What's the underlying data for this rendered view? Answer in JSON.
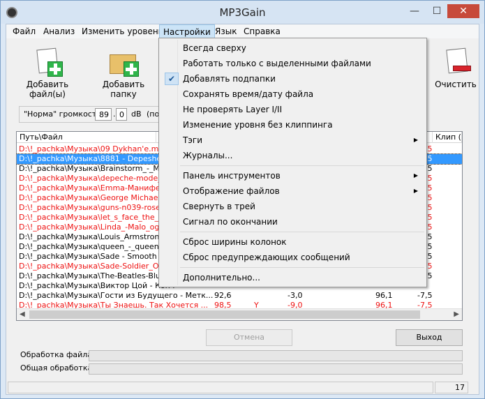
{
  "window": {
    "title": "MP3Gain",
    "minimize": "—",
    "maximize": "☐",
    "close": "✕"
  },
  "menu": [
    "Файл",
    "Анализ",
    "Изменить уровень",
    "Настройки",
    "Язык",
    "Справка"
  ],
  "toolbar": {
    "add_files": "Добавить файл(ы)",
    "add_folder": "Добавить папку",
    "clear": "Очистить"
  },
  "norm": {
    "label": "\"Норма\" громкости:",
    "int": "89",
    "dot": ".",
    "dec": "0",
    "unit": "dB",
    "suffix": "(по у"
  },
  "list": {
    "headers": {
      "path": "Путь\\Файл",
      "clip": "Клип ("
    },
    "rows": [
      {
        "path": "D:\\!_pachka\\Музыка\\09 Dykhan'e.mp3",
        "c1": "",
        "c2": "",
        "c3": "",
        "c4": "",
        "c5": "-7,5",
        "red": true,
        "sel": false
      },
      {
        "path": "D:\\!_pachka\\Музыка\\8881 - Depeshe_M",
        "c1": "",
        "c2": "",
        "c3": "",
        "c4": "",
        "c5": "-7,5",
        "red": false,
        "sel": true
      },
      {
        "path": "D:\\!_pachka\\Музыка\\Brainstorm_-_Mayb",
        "c1": "",
        "c2": "",
        "c3": "",
        "c4": "",
        "c5": "-7,5",
        "red": false,
        "sel": false
      },
      {
        "path": "D:\\!_pachka\\Музыка\\depeche-mode_wal",
        "c1": "",
        "c2": "",
        "c3": "",
        "c4": "",
        "c5": "-7,5",
        "red": true,
        "sel": false
      },
      {
        "path": "D:\\!_pachka\\Музыка\\Emma-Манифест.m",
        "c1": "",
        "c2": "",
        "c3": "",
        "c4": "",
        "c5": "-7,5",
        "red": true,
        "sel": false
      },
      {
        "path": "D:\\!_pachka\\Музыка\\George Michael - Je",
        "c1": "",
        "c2": "",
        "c3": "",
        "c4": "",
        "c5": "-7,5",
        "red": true,
        "sel": false
      },
      {
        "path": "D:\\!_pachka\\Музыка\\guns-n039-roses-kr",
        "c1": "",
        "c2": "",
        "c3": "",
        "c4": "",
        "c5": "-7,5",
        "red": true,
        "sel": false
      },
      {
        "path": "D:\\!_pachka\\Музыка\\let_s_face_the_mus",
        "c1": "",
        "c2": "",
        "c3": "",
        "c4": "",
        "c5": "-7,5",
        "red": true,
        "sel": false
      },
      {
        "path": "D:\\!_pachka\\Музыка\\Linda_-Malo_ognya",
        "c1": "",
        "c2": "",
        "c3": "",
        "c4": "",
        "c5": "-7,5",
        "red": true,
        "sel": false
      },
      {
        "path": "D:\\!_pachka\\Музыка\\Louis_Armstrong_-_",
        "c1": "",
        "c2": "",
        "c3": "",
        "c4": "",
        "c5": "-7,5",
        "red": false,
        "sel": false
      },
      {
        "path": "D:\\!_pachka\\Музыка\\queen_-_queen_-_v",
        "c1": "",
        "c2": "",
        "c3": "",
        "c4": "",
        "c5": "-7,5",
        "red": false,
        "sel": false
      },
      {
        "path": "D:\\!_pachka\\Музыка\\Sade - Smooth Ope",
        "c1": "",
        "c2": "",
        "c3": "",
        "c4": "",
        "c5": "-7,5",
        "red": false,
        "sel": false
      },
      {
        "path": "D:\\!_pachka\\Музыка\\Sade-Soldier_Of_Lo",
        "c1": "",
        "c2": "",
        "c3": "",
        "c4": "",
        "c5": "-7,5",
        "red": true,
        "sel": false
      },
      {
        "path": "D:\\!_pachka\\Музыка\\The-Beatles-Blue-Bl",
        "c1": "",
        "c2": "",
        "c3": "",
        "c4": "",
        "c5": "-7,5",
        "red": false,
        "sel": false
      },
      {
        "path": "D:\\!_pachka\\Музыка\\Виктор Цой - Конч",
        "c1": "",
        "c2": "",
        "c3": "",
        "c4": "",
        "c5": "",
        "red": false,
        "sel": false
      },
      {
        "path": "D:\\!_pachka\\Музыка\\Гости из Будущего - Метк...",
        "c1": "92,6",
        "c2": "",
        "c3": "-3,0",
        "c4": "96,1",
        "c5": "-7,5",
        "red": false,
        "sel": false
      },
      {
        "path": "D:\\!_pachka\\Музыка\\Ты Знаешь. Так Хочется ...",
        "c1": "98,5",
        "c2": "Y",
        "c3": "-9,0",
        "c4": "96,1",
        "c5": "-7,5",
        "red": true,
        "sel": false
      }
    ]
  },
  "buttons": {
    "cancel": "Отмена",
    "exit": "Выход"
  },
  "progress": {
    "file": "Обработка файла",
    "total": "Общая обработка",
    "file_value": 0,
    "total_value": 0
  },
  "status": {
    "count": "17"
  },
  "dropdown": {
    "items": [
      {
        "label": "Всегда сверху",
        "checked": false,
        "sub": false
      },
      {
        "label": "Работать только с выделенными файлами",
        "checked": false,
        "sub": false
      },
      {
        "label": "Добавлять подпапки",
        "checked": true,
        "sub": false
      },
      {
        "label": "Сохранять время/дату файла",
        "checked": false,
        "sub": false
      },
      {
        "label": "Не проверять Layer I/II",
        "checked": false,
        "sub": false
      },
      {
        "label": "Изменение уровня без клиппинга",
        "checked": false,
        "sub": false
      },
      {
        "label": "Тэги",
        "checked": false,
        "sub": true
      },
      {
        "label": "Журналы...",
        "checked": false,
        "sub": false
      },
      {
        "label": "Панель инструментов",
        "checked": false,
        "sub": true
      },
      {
        "label": "Отображение файлов",
        "checked": false,
        "sub": true
      },
      {
        "label": "Свернуть в трей",
        "checked": false,
        "sub": false
      },
      {
        "label": "Сигнал по окончании",
        "checked": false,
        "sub": false
      },
      {
        "label": "Сброс ширины колонок",
        "checked": false,
        "sub": false
      },
      {
        "label": "Сброс предупреждающих сообщений",
        "checked": false,
        "sub": false
      },
      {
        "label": "Дополнительно...",
        "checked": false,
        "sub": false
      }
    ],
    "check_glyph": "✔",
    "submenu_glyph": "▶"
  }
}
